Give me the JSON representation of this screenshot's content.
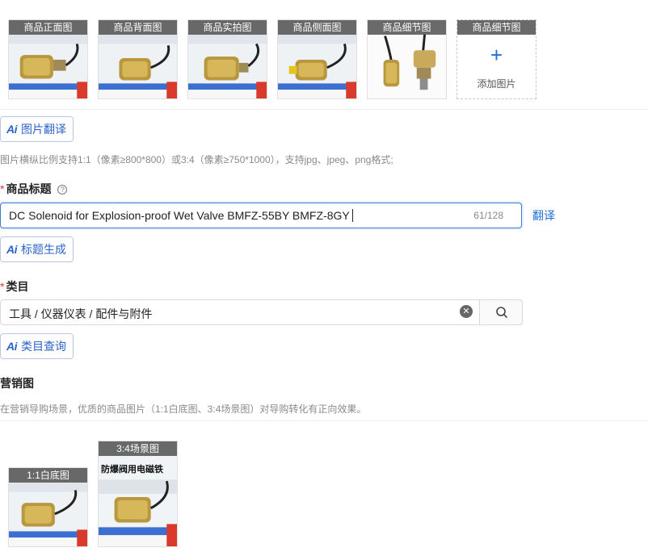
{
  "product_images": [
    {
      "label": "商品正面图",
      "image": "solenoid-product-front"
    },
    {
      "label": "商品背面图",
      "image": "solenoid-product-back"
    },
    {
      "label": "商品实拍图",
      "image": "solenoid-product-real"
    },
    {
      "label": "商品侧面图",
      "image": "solenoid-product-side"
    },
    {
      "label": "商品细节图",
      "image": "solenoid-product-detail"
    },
    {
      "label": "商品细节图",
      "add_label": "添加图片",
      "add_symbol": "+"
    }
  ],
  "ai_image_translate": {
    "ai_mark": "Ai",
    "label": "图片翻译"
  },
  "image_hint": "图片横纵比例支持1:1（像素≥800*800）或3:4（像素≥750*1000），支持jpg、jpeg、png格式;",
  "title_field": {
    "required_mark": "*",
    "label": "商品标题",
    "help_icon": "?",
    "value": "DC Solenoid for Explosion-proof Wet Valve BMFZ-55BY BMFZ-8GY",
    "counter": "61/128",
    "translate_link": "翻译"
  },
  "ai_title_generate": {
    "ai_mark": "Ai",
    "label": "标题生成"
  },
  "category_field": {
    "required_mark": "*",
    "label": "类目",
    "value": "工具 / 仪器仪表 / 配件与附件"
  },
  "ai_category_query": {
    "ai_mark": "Ai",
    "label": "类目查询"
  },
  "marketing": {
    "label": "营销图",
    "hint": "在营销导购场景，优质的商品图片（1:1白底图、3:4场景图）对导购转化有正向效果。",
    "images": [
      {
        "label": "1:1白底图"
      },
      {
        "label": "3:4场景图",
        "banner_text": "防爆阀用电磁铁"
      }
    ]
  },
  "colors": {
    "accent": "#1e6fd9",
    "required": "#e0393e",
    "ai_border": "#b9c8ea"
  }
}
